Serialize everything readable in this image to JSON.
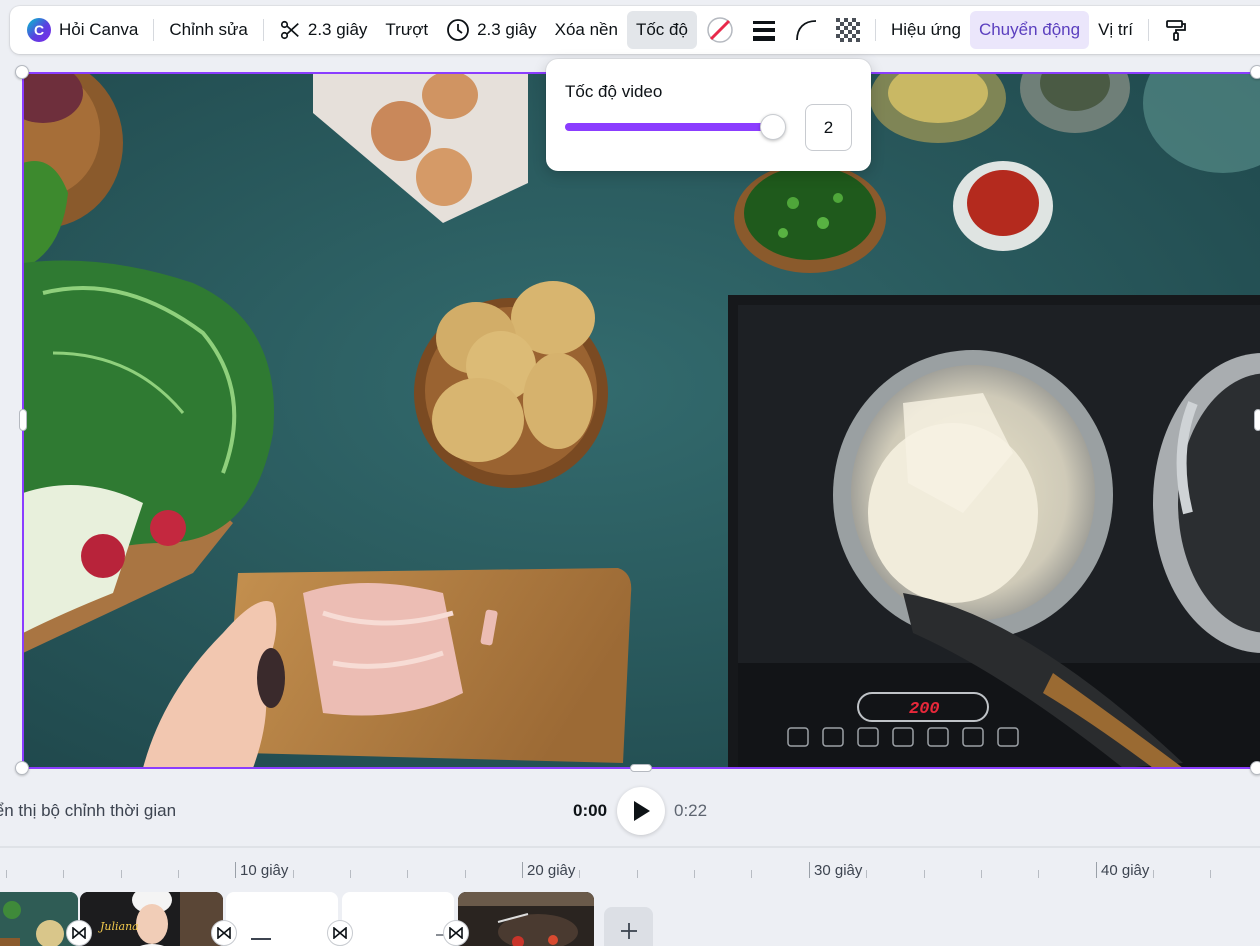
{
  "toolbar": {
    "ask_canva": "Hỏi Canva",
    "edit": "Chỉnh sửa",
    "trim_duration": "2.3 giây",
    "transition": "Trượt",
    "timing_duration": "2.3 giây",
    "remove_background": "Xóa nền",
    "speed": "Tốc độ",
    "effects": "Hiệu ứng",
    "animate": "Chuyển động",
    "position": "Vị trí"
  },
  "speed_popover": {
    "title": "Tốc độ video",
    "value": "2",
    "fraction": 1.0
  },
  "playback": {
    "timeline_toggle": "iển thị bộ chỉnh thời gian",
    "current_time": "0:00",
    "total_time": "0:22"
  },
  "ruler": {
    "labels": [
      "10 giây",
      "20 giây",
      "30 giây",
      "40 giây"
    ]
  },
  "clips": {
    "thumb_text": "Juliana"
  },
  "colors": {
    "accent": "#8b3dff",
    "active_tab_bg": "#ebe6fb",
    "active_tab_text": "#5b3fbf"
  }
}
